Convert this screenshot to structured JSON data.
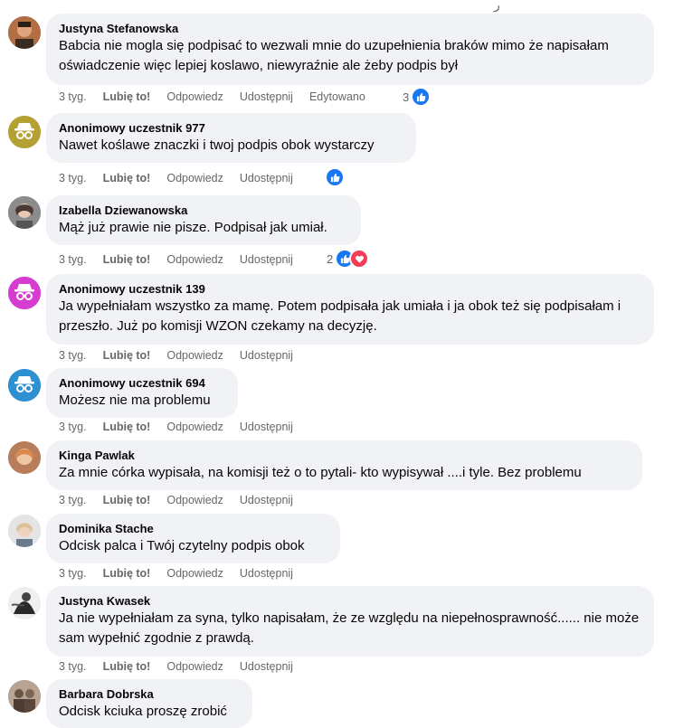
{
  "comments": [
    {
      "author": "Justyna Stefanowska",
      "text": "Babcia nie mogla się podpisać to wezwali mnie do uzupełnienia braków mimo że napisałam oświadczenie więc lepiej koslawo, niewyraźnie ale żeby podpis był",
      "time": "3 tyg.",
      "like": "Lubię to!",
      "reply": "Odpowiedz",
      "share": "Udostępnij",
      "edited": "Edytowano",
      "reaction_count": "3"
    },
    {
      "author": "Anonimowy uczestnik 977",
      "text": "Nawet koślawe znaczki i twoj podpis obok wystarczy",
      "time": "3 tyg.",
      "like": "Lubię to!",
      "reply": "Odpowiedz",
      "share": "Udostępnij"
    },
    {
      "author": "Izabella Dziewanowska",
      "text": "Mąż już prawie nie pisze. Podpisał jak umiał.",
      "time": "3 tyg.",
      "like": "Lubię to!",
      "reply": "Odpowiedz",
      "share": "Udostępnij",
      "reaction_count": "2"
    },
    {
      "author": "Anonimowy uczestnik 139",
      "text": "Ja wypełniałam wszystko za mamę. Potem podpisała jak umiała i ja obok też się podpisałam i przeszło. Już po komisji WZON czekamy na decyzję.",
      "time": "3 tyg.",
      "like": "Lubię to!",
      "reply": "Odpowiedz",
      "share": "Udostępnij"
    },
    {
      "author": "Anonimowy uczestnik 694",
      "text": "Możesz nie ma problemu",
      "time": "3 tyg.",
      "like": "Lubię to!",
      "reply": "Odpowiedz",
      "share": "Udostępnij"
    },
    {
      "author": "Kinga Pawlak",
      "text": "Za mnie córka wypisała, na komisji też o to pytali- kto wypisywał ....i tyle. Bez problemu",
      "time": "3 tyg.",
      "like": "Lubię to!",
      "reply": "Odpowiedz",
      "share": "Udostępnij"
    },
    {
      "author": "Dominika Stache",
      "text": "Odcisk palca i Twój czytelny podpis obok",
      "time": "3 tyg.",
      "like": "Lubię to!",
      "reply": "Odpowiedz",
      "share": "Udostępnij"
    },
    {
      "author": "Justyna Kwasek",
      "text": "Ja nie wypełniałam za syna, tylko napisałam, że ze względu na niepełnosprawność...... nie może sam wypełnić zgodnie z prawdą.",
      "time": "3 tyg.",
      "like": "Lubię to!",
      "reply": "Odpowiedz",
      "share": "Udostępnij"
    },
    {
      "author": "Barbara Dobrska",
      "text": "Odcisk kciuka proszę zrobić"
    }
  ],
  "colors": {
    "anon_977": "#b5a133",
    "anon_139": "#d63cd0",
    "anon_694": "#2e8fd1",
    "like_blue": "#1877f2",
    "love_red": "#f33e58"
  }
}
